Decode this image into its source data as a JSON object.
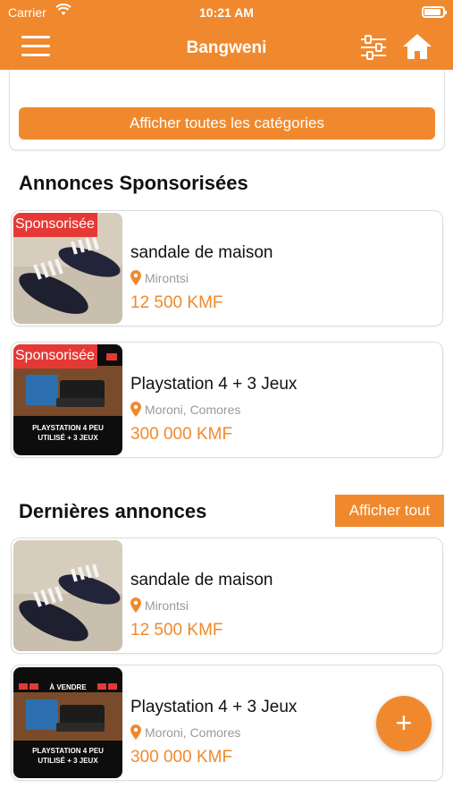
{
  "status_bar": {
    "carrier": "Carrier",
    "time": "10:21 AM"
  },
  "header": {
    "title": "Bangweni",
    "menu_icon": "hamburger-menu-icon",
    "filter_icon": "sliders-icon",
    "home_icon": "home-icon"
  },
  "categories": {
    "show_all_label": "Afficher toutes les catégories"
  },
  "sponsored": {
    "title": "Annonces Sponsorisées",
    "items": [
      {
        "badge": "Sponsorisée",
        "title": "sandale de maison",
        "location": "Mirontsi",
        "price": "12 500 KMF"
      },
      {
        "badge": "Sponsorisée",
        "title": "Playstation 4 + 3 Jeux",
        "location": "Moroni, Comores",
        "price": "300 000 KMF",
        "image_caption": "PLAYSTATION 4 PEU UTILISÉ + 3 JEUX"
      }
    ]
  },
  "latest": {
    "title": "Dernières annonces",
    "see_all_label": "Afficher tout",
    "items": [
      {
        "title": "sandale de maison",
        "location": "Mirontsi",
        "price": "12 500 KMF"
      },
      {
        "title": "Playstation 4 + 3 Jeux",
        "location": "Moroni, Comores",
        "price": "300 000 KMF",
        "image_top": "À VENDRE",
        "image_caption": "PLAYSTATION 4 PEU UTILISÉ + 3 JEUX"
      }
    ]
  },
  "fab": {
    "label": "+",
    "icon": "plus-icon"
  },
  "colors": {
    "accent": "#f0892e",
    "badge": "#e53935"
  }
}
